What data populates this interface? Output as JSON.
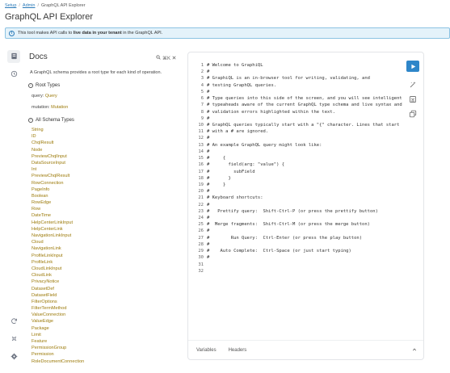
{
  "breadcrumb": {
    "items": [
      "Setup",
      "Admin",
      "GraphQL API Explorer"
    ],
    "separator": "/"
  },
  "page_title": "GraphQL API Explorer",
  "banner": {
    "before": "This tool makes API calls to",
    "bold": "live data in your tenant",
    "after": "in the GraphQL API."
  },
  "docs": {
    "title": "Docs",
    "shortcut": "⌘K",
    "description": "A GraphQL schema provides a root type for each kind of operation.",
    "root_types_heading": "Root Types",
    "root_types": [
      {
        "label": "query:",
        "type": "Query"
      },
      {
        "label": "mutation:",
        "type": "Mutation"
      }
    ],
    "all_types_heading": "All Schema Types",
    "types": [
      "String",
      "ID",
      "ChqlResult",
      "Node",
      "PreviewChqlInput",
      "DataSourceInput",
      "Int",
      "PreviewChqlResult",
      "RowConnection",
      "PageInfo",
      "Boolean",
      "RowEdge",
      "Row",
      "DateTime",
      "HelpCenterLinkInput",
      "HelpCenterLink",
      "NavigationLinkInput",
      "Cloud",
      "NavigationLink",
      "ProfileLinkInput",
      "ProfileLink",
      "CloudLinkInput",
      "CloudLink",
      "PrivacyNotice",
      "DatasetDef",
      "DatasetField",
      "FilterOptions",
      "FilterTermMethod",
      "ValueConnection",
      "ValueEdge",
      "Package",
      "Limit",
      "Feature",
      "PermissionGroup",
      "Permission",
      "RoleDocumentConnection"
    ]
  },
  "editor": {
    "lines": [
      "# Welcome to GraphiQL",
      "#",
      "# GraphiQL is an in-browser tool for writing, validating, and",
      "# testing GraphQL queries.",
      "#",
      "# Type queries into this side of the screen, and you will see intelligent",
      "# typeaheads aware of the current GraphQL type schema and live syntax and",
      "# validation errors highlighted within the text.",
      "#",
      "# GraphQL queries typically start with a \"{\" character. Lines that start",
      "# with a # are ignored.",
      "#",
      "# An example GraphQL query might look like:",
      "#",
      "#     {",
      "#       field(arg: \"value\") {",
      "#         subField",
      "#       }",
      "#     }",
      "#",
      "# Keyboard shortcuts:",
      "#",
      "#   Prettify query:  Shift-Ctrl-P (or press the prettify button)",
      "#",
      "#  Merge fragments:  Shift-Ctrl-M (or press the merge button)",
      "#",
      "#        Run Query:  Ctrl-Enter (or press the play button)",
      "#",
      "#    Auto Complete:  Ctrl-Space (or just start typing)",
      "#",
      "",
      ""
    ],
    "tabs": [
      "Variables",
      "Headers"
    ]
  },
  "colors": {
    "accent": "#2e86c9",
    "type_text": "#9c7a0a",
    "banner_bg": "#e4f2fa",
    "banner_border": "#8cc3e3"
  }
}
